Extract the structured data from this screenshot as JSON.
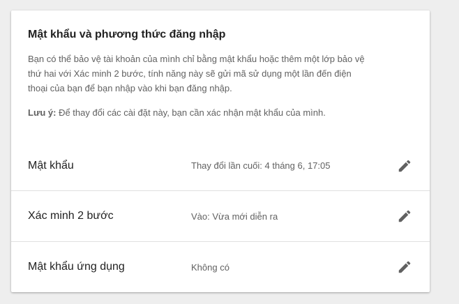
{
  "section": {
    "title": "Mật khẩu và phương thức đăng nhập",
    "description": "Bạn có thể bảo vệ tài khoản của mình chỉ bằng mật khẩu hoặc thêm một lớp bảo vệ thứ hai với Xác minh 2 bước, tính năng này sẽ gửi mã sử dụng một lần đến điện thoại của bạn để bạn nhập vào khi bạn đăng nhập.",
    "note_label": "Lưu ý:",
    "note_text": " Để thay đổi các cài đặt này, bạn cần xác nhận mật khẩu của mình."
  },
  "rows": [
    {
      "label": "Mật khẩu",
      "value": "Thay đổi lần cuối: 4 tháng 6, 17:05",
      "icon": "pencil-icon"
    },
    {
      "label": "Xác minh 2 bước",
      "value": "Vào: Vừa mới diễn ra",
      "icon": "pencil-icon"
    },
    {
      "label": "Mật khẩu ứng dụng",
      "value": "Không có",
      "icon": "pencil-icon"
    }
  ]
}
